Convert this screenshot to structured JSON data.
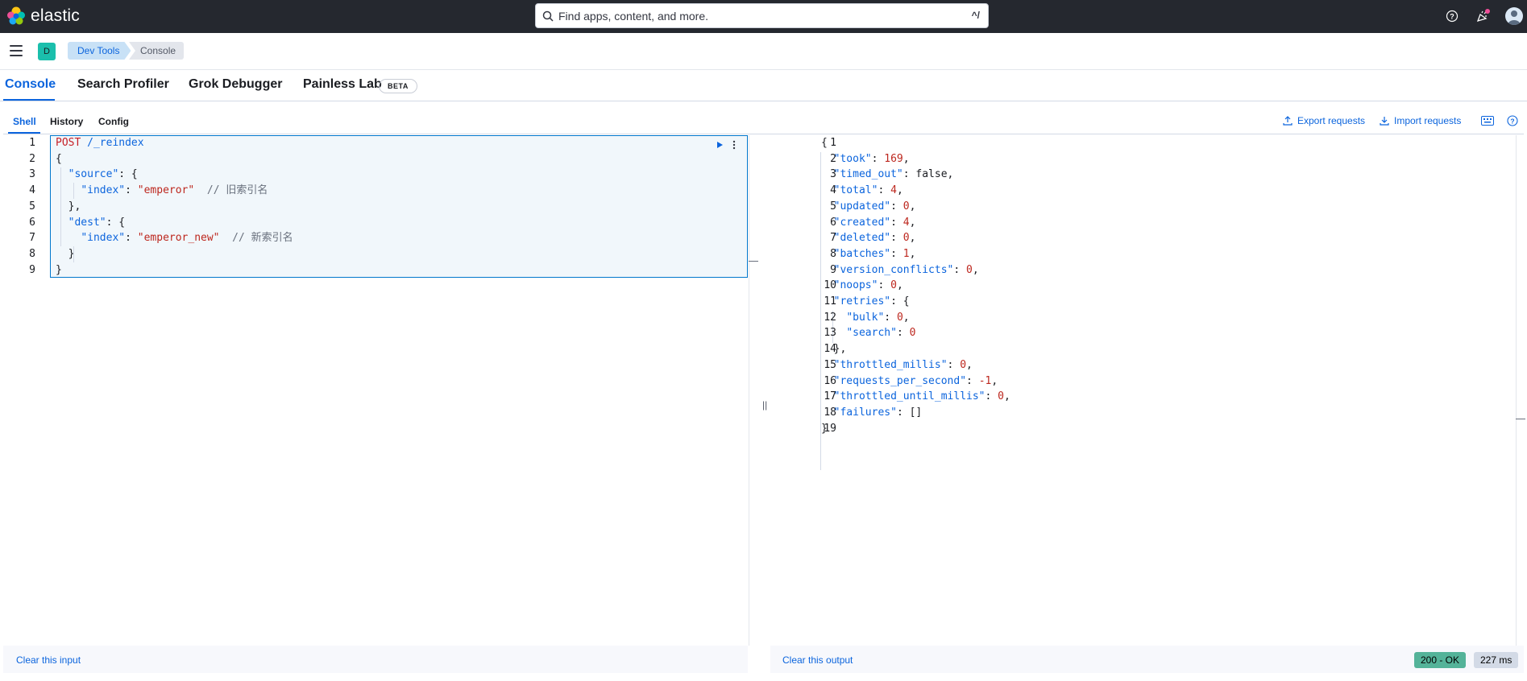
{
  "header": {
    "brand": "elastic",
    "search_placeholder": "Find apps, content, and more.",
    "search_shortcut": "^/"
  },
  "breadcrumbs": {
    "space_initial": "D",
    "items": [
      "Dev Tools",
      "Console"
    ]
  },
  "tabs": [
    {
      "label": "Console",
      "active": true
    },
    {
      "label": "Search Profiler",
      "active": false
    },
    {
      "label": "Grok Debugger",
      "active": false
    },
    {
      "label": "Painless Lab",
      "active": false,
      "badge": "BETA"
    }
  ],
  "subtabs": [
    {
      "label": "Shell",
      "active": true
    },
    {
      "label": "History",
      "active": false
    },
    {
      "label": "Config",
      "active": false
    }
  ],
  "actions": {
    "export": "Export requests",
    "import": "Import requests"
  },
  "editor": {
    "lines": [
      {
        "num": "1",
        "text": "POST /_reindex"
      },
      {
        "num": "2",
        "text": "{"
      },
      {
        "num": "3",
        "text": "  \"source\": {"
      },
      {
        "num": "4",
        "text": "    \"index\": \"emperor\"  // 旧索引名"
      },
      {
        "num": "5",
        "text": "  },"
      },
      {
        "num": "6",
        "text": "  \"dest\": {"
      },
      {
        "num": "7",
        "text": "    \"index\": \"emperor_new\"  // 新索引名"
      },
      {
        "num": "8",
        "text": "  }"
      },
      {
        "num": "9",
        "text": "}"
      }
    ],
    "clear_label": "Clear this input"
  },
  "output": {
    "lines": [
      {
        "num": "1",
        "text": "{"
      },
      {
        "num": "2",
        "text": "  \"took\": 169,"
      },
      {
        "num": "3",
        "text": "  \"timed_out\": false,"
      },
      {
        "num": "4",
        "text": "  \"total\": 4,"
      },
      {
        "num": "5",
        "text": "  \"updated\": 0,"
      },
      {
        "num": "6",
        "text": "  \"created\": 4,"
      },
      {
        "num": "7",
        "text": "  \"deleted\": 0,"
      },
      {
        "num": "8",
        "text": "  \"batches\": 1,"
      },
      {
        "num": "9",
        "text": "  \"version_conflicts\": 0,"
      },
      {
        "num": "10",
        "text": "  \"noops\": 0,"
      },
      {
        "num": "11",
        "text": "  \"retries\": {"
      },
      {
        "num": "12",
        "text": "    \"bulk\": 0,"
      },
      {
        "num": "13",
        "text": "    \"search\": 0"
      },
      {
        "num": "14",
        "text": "  },"
      },
      {
        "num": "15",
        "text": "  \"throttled_millis\": 0,"
      },
      {
        "num": "16",
        "text": "  \"requests_per_second\": -1,"
      },
      {
        "num": "17",
        "text": "  \"throttled_until_millis\": 0,"
      },
      {
        "num": "18",
        "text": "  \"failures\": []"
      },
      {
        "num": "19",
        "text": "}"
      }
    ],
    "clear_label": "Clear this output"
  },
  "status": {
    "code": "200 - OK",
    "time": "227 ms",
    "ok_color": "#54b399"
  }
}
